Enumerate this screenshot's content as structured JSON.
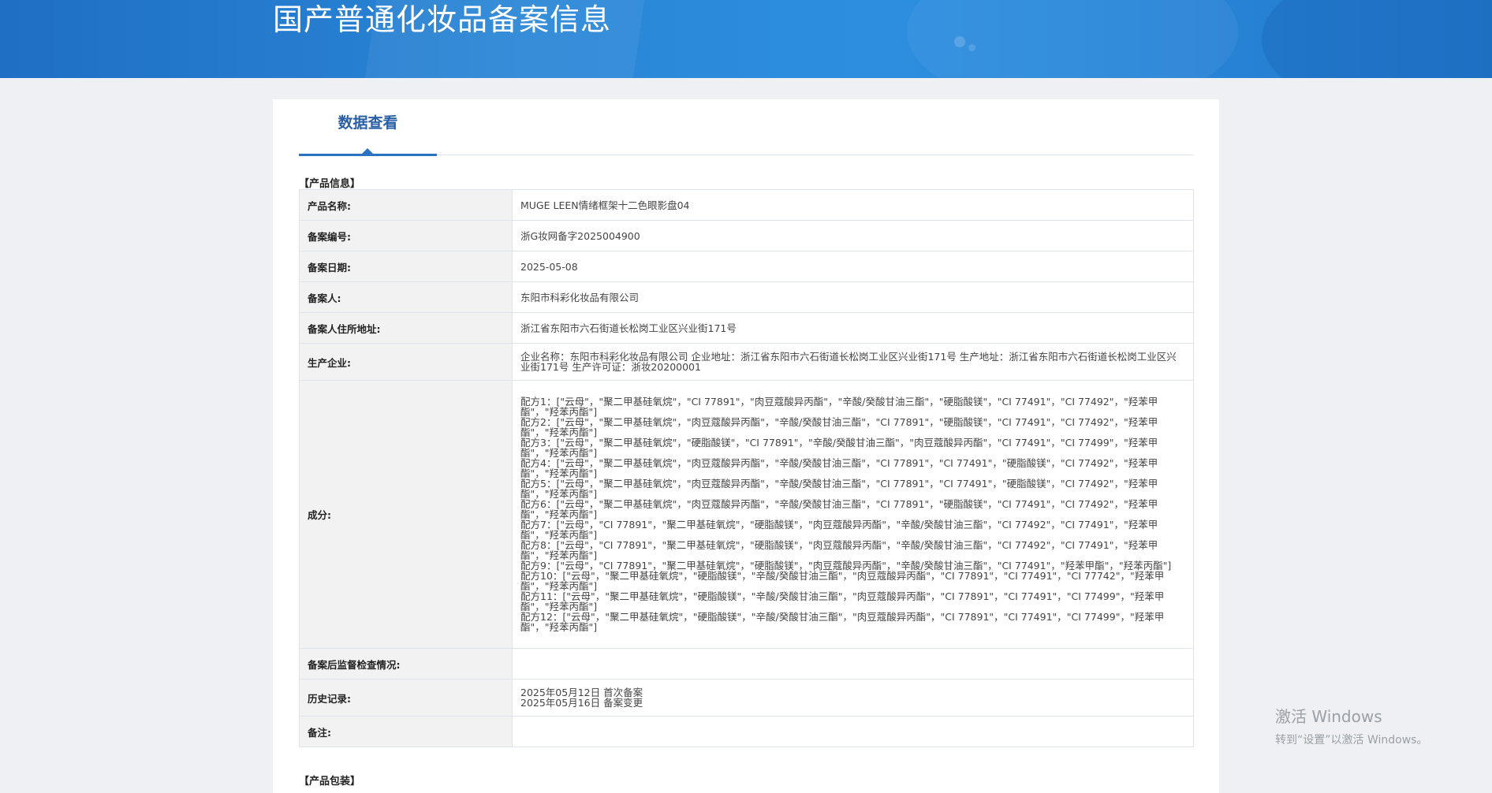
{
  "header": {
    "title": "国产普通化妆品备案信息"
  },
  "tabs": [
    {
      "label": "数据查看"
    }
  ],
  "sections": {
    "product_info": "【产品信息】",
    "product_packaging": "【产品包装】"
  },
  "rows": {
    "name": {
      "label": "产品名称:",
      "value": "MUGE LEEN情绪框架十二色眼影盘04"
    },
    "record_no": {
      "label": "备案编号:",
      "value": "浙G妆网备字2025004900"
    },
    "record_date": {
      "label": "备案日期:",
      "value": "2025-05-08"
    },
    "registrant": {
      "label": "备案人:",
      "value": "东阳市科彩化妆品有限公司"
    },
    "address": {
      "label": "备案人住所地址:",
      "value": "浙江省东阳市六石街道长松岗工业区兴业街171号"
    },
    "manufacturer": {
      "label": "生产企业:",
      "value": "企业名称：东阳市科彩化妆品有限公司 企业地址：浙江省东阳市六石街道长松岗工业区兴业街171号 生产地址：浙江省东阳市六石街道长松岗工业区兴业街171号 生产许可证：浙妆20200001"
    },
    "ingredients": {
      "label": "成分:",
      "value": "配方1：[\"云母\"，\"聚二甲基硅氧烷\"，\"CI 77891\"，\"肉豆蔻酸异丙酯\"，\"辛酸/癸酸甘油三酯\"，\"硬脂酸镁\"，\"CI 77491\"，\"CI 77492\"，\"羟苯甲酯\"，\"羟苯丙酯\"]\n配方2：[\"云母\"，\"聚二甲基硅氧烷\"，\"肉豆蔻酸异丙酯\"，\"辛酸/癸酸甘油三酯\"，\"CI 77891\"，\"硬脂酸镁\"，\"CI 77491\"，\"CI 77492\"，\"羟苯甲酯\"，\"羟苯丙酯\"]\n配方3：[\"云母\"，\"聚二甲基硅氧烷\"，\"硬脂酸镁\"，\"CI 77891\"，\"辛酸/癸酸甘油三酯\"，\"肉豆蔻酸异丙酯\"，\"CI 77491\"，\"CI 77499\"，\"羟苯甲酯\"，\"羟苯丙酯\"]\n配方4：[\"云母\"，\"聚二甲基硅氧烷\"，\"肉豆蔻酸异丙酯\"，\"辛酸/癸酸甘油三酯\"，\"CI 77891\"，\"CI 77491\"，\"硬脂酸镁\"，\"CI 77492\"，\"羟苯甲酯\"，\"羟苯丙酯\"]\n配方5：[\"云母\"，\"聚二甲基硅氧烷\"，\"肉豆蔻酸异丙酯\"，\"辛酸/癸酸甘油三酯\"，\"CI 77891\"，\"CI 77491\"，\"硬脂酸镁\"，\"CI 77492\"，\"羟苯甲酯\"，\"羟苯丙酯\"]\n配方6：[\"云母\"，\"聚二甲基硅氧烷\"，\"肉豆蔻酸异丙酯\"，\"辛酸/癸酸甘油三酯\"，\"CI 77891\"，\"硬脂酸镁\"，\"CI 77491\"，\"CI 77492\"，\"羟苯甲酯\"，\"羟苯丙酯\"]\n配方7：[\"云母\"，\"CI 77891\"，\"聚二甲基硅氧烷\"，\"硬脂酸镁\"，\"肉豆蔻酸异丙酯\"，\"辛酸/癸酸甘油三酯\"，\"CI 77492\"，\"CI 77491\"，\"羟苯甲酯\"，\"羟苯丙酯\"]\n配方8：[\"云母\"，\"CI 77891\"，\"聚二甲基硅氧烷\"，\"硬脂酸镁\"，\"肉豆蔻酸异丙酯\"，\"辛酸/癸酸甘油三酯\"，\"CI 77492\"，\"CI 77491\"，\"羟苯甲酯\"，\"羟苯丙酯\"]\n配方9：[\"云母\"，\"CI 77891\"，\"聚二甲基硅氧烷\"，\"硬脂酸镁\"，\"肉豆蔻酸异丙酯\"，\"辛酸/癸酸甘油三酯\"，\"CI 77491\"，\"羟苯甲酯\"，\"羟苯丙酯\"]\n配方10：[\"云母\"，\"聚二甲基硅氧烷\"，\"硬脂酸镁\"，\"辛酸/癸酸甘油三酯\"，\"肉豆蔻酸异丙酯\"，\"CI 77891\"，\"CI 77491\"，\"CI 77742\"，\"羟苯甲酯\"，\"羟苯丙酯\"]\n配方11：[\"云母\"，\"聚二甲基硅氧烷\"，\"硬脂酸镁\"，\"辛酸/癸酸甘油三酯\"，\"肉豆蔻酸异丙酯\"，\"CI 77891\"，\"CI 77491\"，\"CI 77499\"，\"羟苯甲酯\"，\"羟苯丙酯\"]\n配方12：[\"云母\"，\"聚二甲基硅氧烷\"，\"硬脂酸镁\"，\"辛酸/癸酸甘油三酯\"，\"肉豆蔻酸异丙酯\"，\"CI 77891\"，\"CI 77491\"，\"CI 77499\"，\"羟苯甲酯\"，\"羟苯丙酯\"]"
    },
    "inspection": {
      "label": "备案后监督检查情况:",
      "value": ""
    },
    "history": {
      "label": "历史记录:",
      "value": "2025年05月12日 首次备案\n2025年05月16日 备案变更"
    },
    "remarks": {
      "label": "备注:",
      "value": ""
    }
  },
  "watermark": {
    "line1": "激活 Windows",
    "line2": "转到“设置”以激活 Windows。"
  }
}
